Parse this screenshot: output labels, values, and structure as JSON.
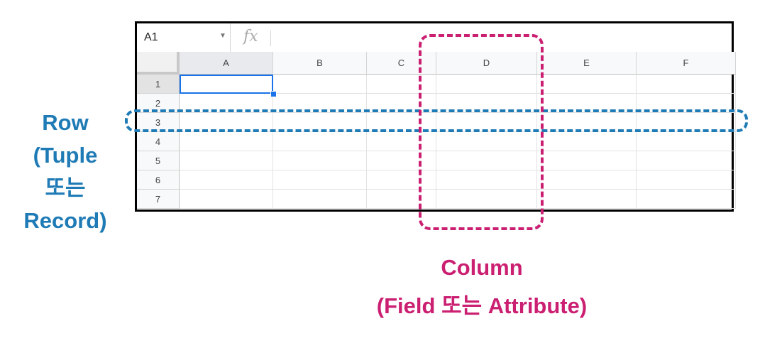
{
  "sheet": {
    "name_box": "A1",
    "formula_icon": "fx",
    "columns": [
      "A",
      "B",
      "C",
      "D",
      "E",
      "F"
    ],
    "rows": [
      "1",
      "2",
      "3",
      "4",
      "5",
      "6",
      "7"
    ],
    "selected_cell": "A1"
  },
  "annotations": {
    "row": {
      "lines": [
        "Row",
        "(Tuple",
        "또는",
        "Record)"
      ],
      "color": "#1f7bb5",
      "highlighted_row": "3"
    },
    "column": {
      "lines": [
        "Column",
        "(Field 또는 Attribute)"
      ],
      "color": "#cb1f72",
      "highlighted_column": "D"
    }
  },
  "icons": {
    "name_box_dropdown": "caret-down-icon",
    "formula": "fx-icon"
  }
}
